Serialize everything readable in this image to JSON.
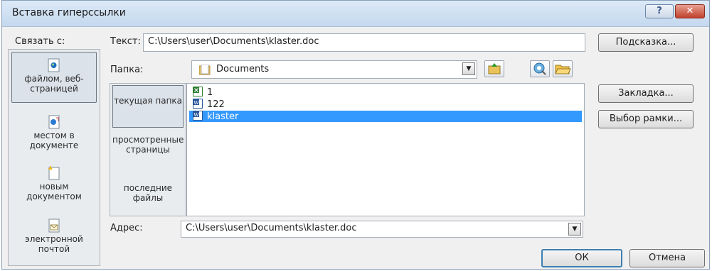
{
  "window": {
    "title": "Вставка гиперссылки",
    "help_glyph": "?",
    "close_glyph": "✕"
  },
  "link_to": {
    "label": "Связать с:",
    "items": [
      {
        "label": "файлом, веб-страницей",
        "selected": true,
        "icon": "web-page-icon"
      },
      {
        "label": "местом в документе",
        "selected": false,
        "icon": "place-in-document-icon"
      },
      {
        "label": "новым документом",
        "selected": false,
        "icon": "new-document-icon"
      },
      {
        "label": "электронной почтой",
        "selected": false,
        "icon": "email-icon"
      }
    ]
  },
  "text_field": {
    "label": "Текст:",
    "value": "C:\\Users\\user\\Documents\\klaster.doc"
  },
  "screentip_button": "Подсказка...",
  "folder": {
    "label": "Папка:",
    "value": "Documents"
  },
  "look_in": {
    "items": [
      {
        "label": "текущая папка",
        "selected": true
      },
      {
        "label": "просмотренные страницы",
        "selected": false
      },
      {
        "label": "последние файлы",
        "selected": false
      }
    ]
  },
  "files": [
    {
      "name": "1",
      "type": "excel",
      "selected": false
    },
    {
      "name": "122",
      "type": "word",
      "selected": false
    },
    {
      "name": "klaster",
      "type": "word",
      "selected": true
    }
  ],
  "bookmark_button": "Закладка...",
  "target_frame_button": "Выбор рамки...",
  "address": {
    "label": "Адрес:",
    "value": "C:\\Users\\user\\Documents\\klaster.doc"
  },
  "ok_button": "ОК",
  "cancel_button": "Отмена",
  "colors": {
    "selection": "#3399ff",
    "dialog_bg": "#f0f0f0",
    "close_button": "#c0412b"
  }
}
